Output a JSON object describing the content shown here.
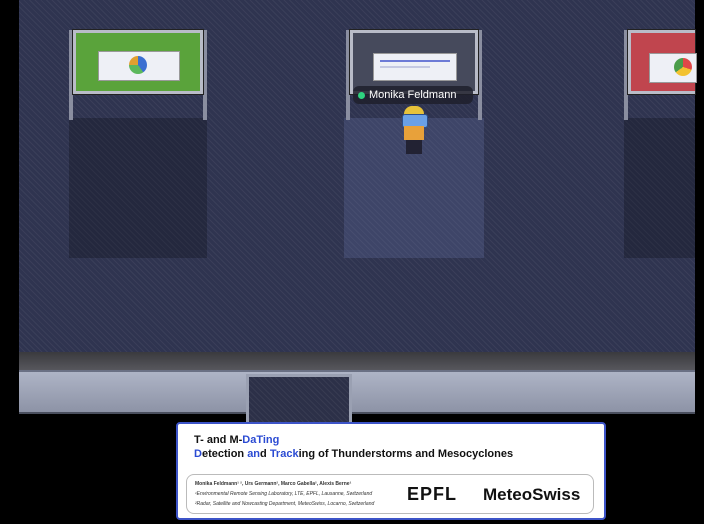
{
  "player": {
    "name": "Monika Feldmann",
    "status_color": "#2ed37f"
  },
  "posters": [
    {
      "id": "left",
      "color": "#5aa33b"
    },
    {
      "id": "center",
      "color": "#464a5c"
    },
    {
      "id": "right",
      "color": "#c0454e"
    }
  ],
  "card": {
    "title_line1": {
      "plain1": "T- and M-",
      "hl1": "DaTing"
    },
    "title_line2": {
      "seg1": "D",
      "seg2": "etection ",
      "seg3": "an",
      "seg4": "d ",
      "seg5": "Track",
      "seg6": "ing",
      "seg7": " of Thunderstorms and Mesocyclones"
    },
    "authors": "Monika Feldmann¹ ², Urs Germann², Marco Gabella², Alexis Berne¹",
    "affil1": "¹Environmental Remote Sensing Laboratory, LTE, EPFL, Lausanne, Switzerland",
    "affil2": "²Radar, Satellite and Nowcasting Department, MeteoSwiss, Locarno, Switzerland",
    "logo1": "EPFL",
    "logo2": "MeteoSwiss"
  }
}
